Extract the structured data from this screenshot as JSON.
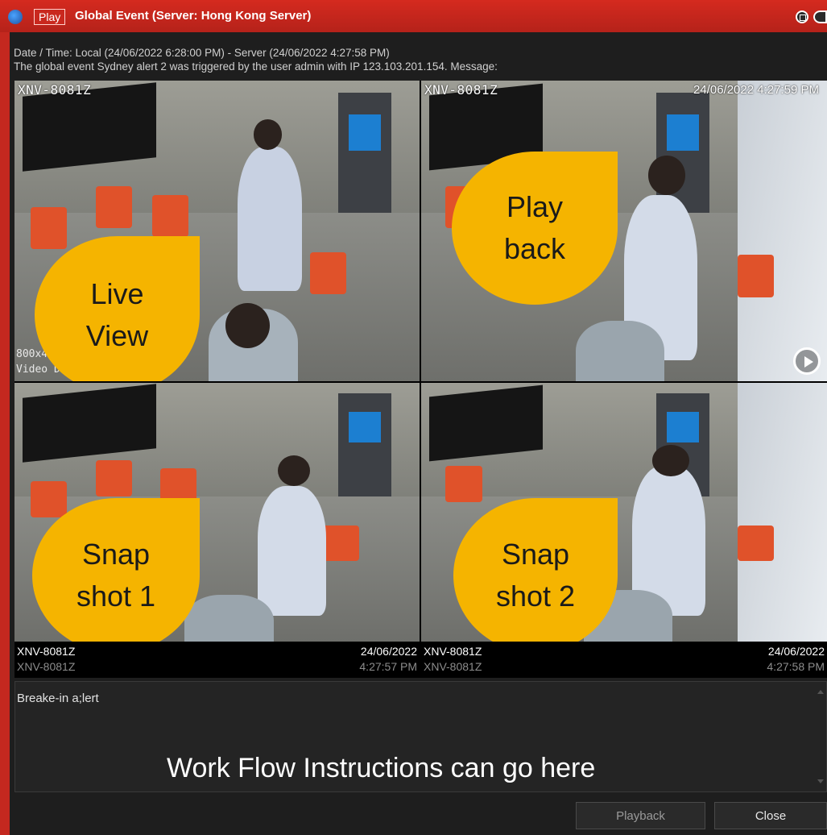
{
  "window": {
    "mode_badge": "Play",
    "title": "Global Event (Server: Hong Kong Server)"
  },
  "info": {
    "datetime": "Date / Time: Local (24/06/2022 6:28:00 PM) - Server (24/06/2022 4:27:58 PM)",
    "message": "The global event Sydney alert 2 was triggered by the user admin with IP 123.103.201.154. Message:"
  },
  "tiles": [
    {
      "camera": "XNV-8081Z",
      "timestamp": "",
      "overlay_1": "800x4",
      "overlay_2": "Video Dec",
      "callout": "Live\nView"
    },
    {
      "camera": "XNV-8081Z",
      "timestamp": "24/06/2022 4:27:59 PM",
      "callout": "Play\nback"
    },
    {
      "callout": "Snap\nshot 1"
    },
    {
      "callout": "Snap\nshot 2"
    }
  ],
  "captions": [
    {
      "name": "XNV-8081Z",
      "sub": "XNV-8081Z",
      "date": "24/06/2022",
      "time": "4:27:57 PM"
    },
    {
      "name": "XNV-8081Z",
      "sub": "XNV-8081Z",
      "date": "24/06/2022",
      "time": "4:27:58 PM"
    }
  ],
  "message_box": {
    "text": "Breake-in a;lert",
    "instructions": "Work Flow Instructions can go here"
  },
  "buttons": {
    "playback": "Playback",
    "close": "Close"
  },
  "colors": {
    "titlebar": "#c4281f",
    "callout": "#f5b400",
    "background": "#1e1e1e"
  }
}
